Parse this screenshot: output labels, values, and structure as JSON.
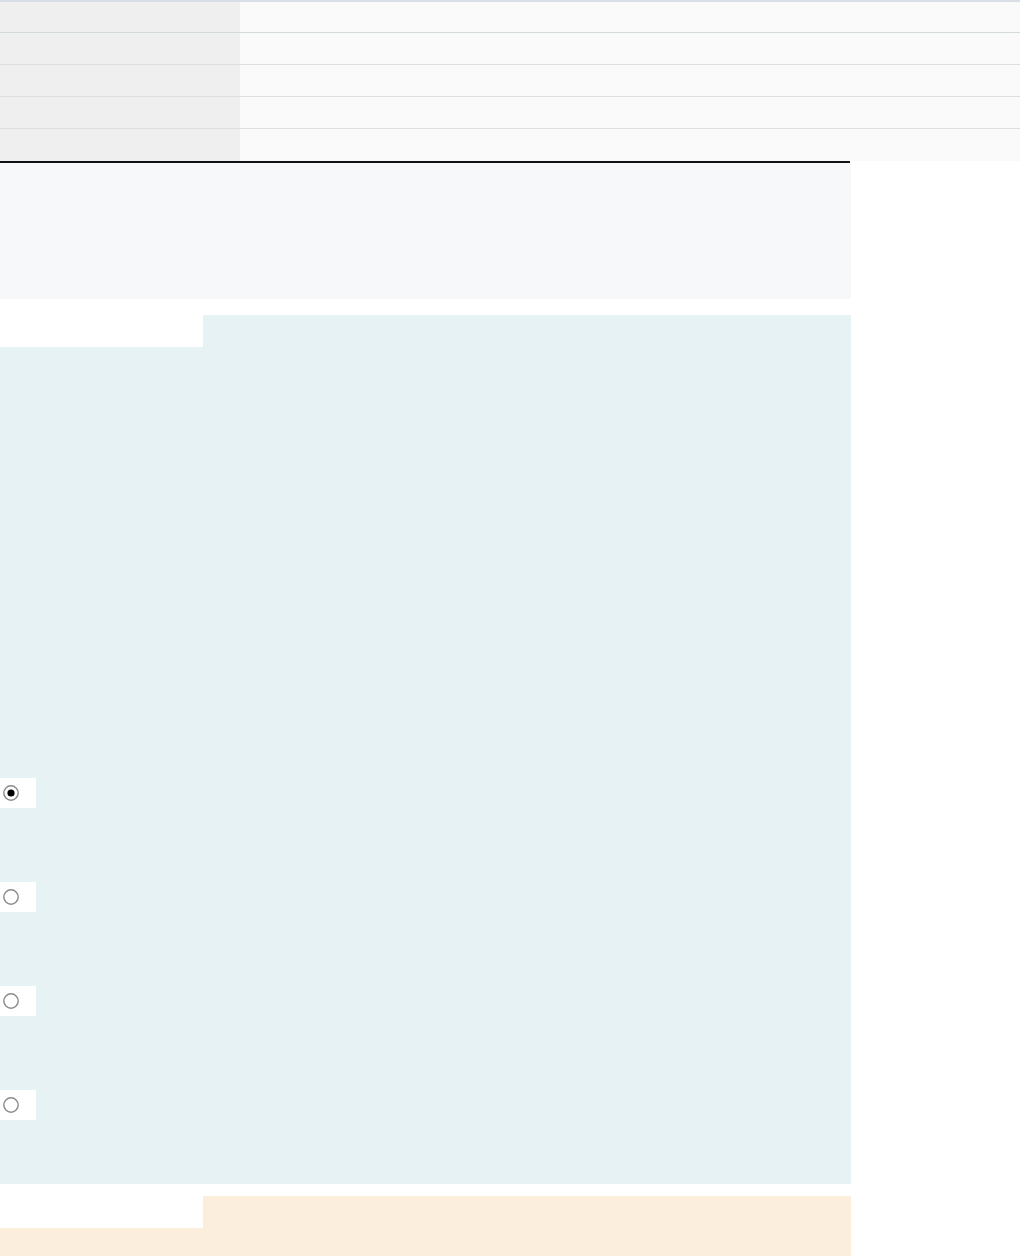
{
  "answer_options": [
    {
      "selected": true
    },
    {
      "selected": false
    },
    {
      "selected": false
    },
    {
      "selected": false
    }
  ]
}
